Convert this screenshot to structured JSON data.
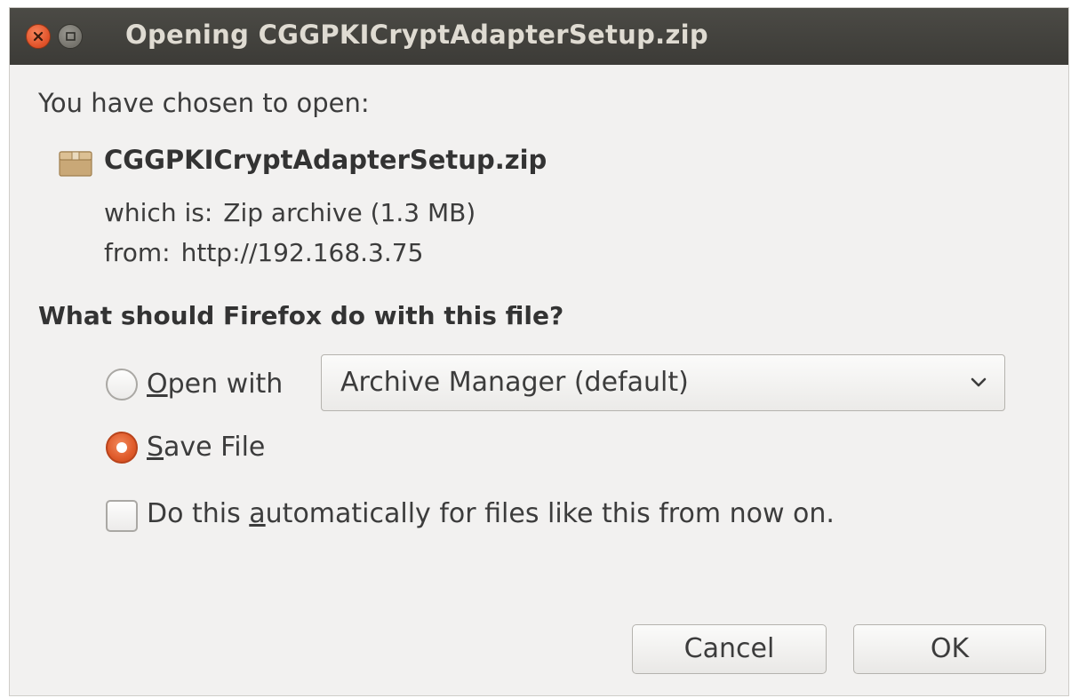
{
  "window": {
    "title": "Opening CGGPKICryptAdapterSetup.zip",
    "controls": {
      "close_icon": "close-icon",
      "maximize_icon": "maximize-icon"
    }
  },
  "dialog": {
    "intro": "You have chosen to open:",
    "file": {
      "icon": "archive-file-icon",
      "name": "CGGPKICryptAdapterSetup.zip",
      "type_label": "which is:",
      "type_value": "Zip archive (1.3 MB)",
      "from_label": "from:",
      "from_value": "http://192.168.3.75"
    },
    "question": "What should Firefox do with this file?",
    "options": {
      "open_with": {
        "label_accel": "O",
        "label_rest": "pen with",
        "selected": false,
        "app_select": {
          "value": "Archive Manager (default)"
        }
      },
      "save_file": {
        "label_accel": "S",
        "label_rest": "ave File",
        "selected": true
      }
    },
    "auto_checkbox": {
      "label_pre": "Do this ",
      "label_accel": "a",
      "label_rest": "utomatically for files like this from now on.",
      "checked": false
    },
    "buttons": {
      "cancel": "Cancel",
      "ok": "OK"
    }
  },
  "colors": {
    "titlebar": "#3c3b37",
    "accent": "#df5a2a",
    "dialog_bg": "#f2f1f0"
  }
}
